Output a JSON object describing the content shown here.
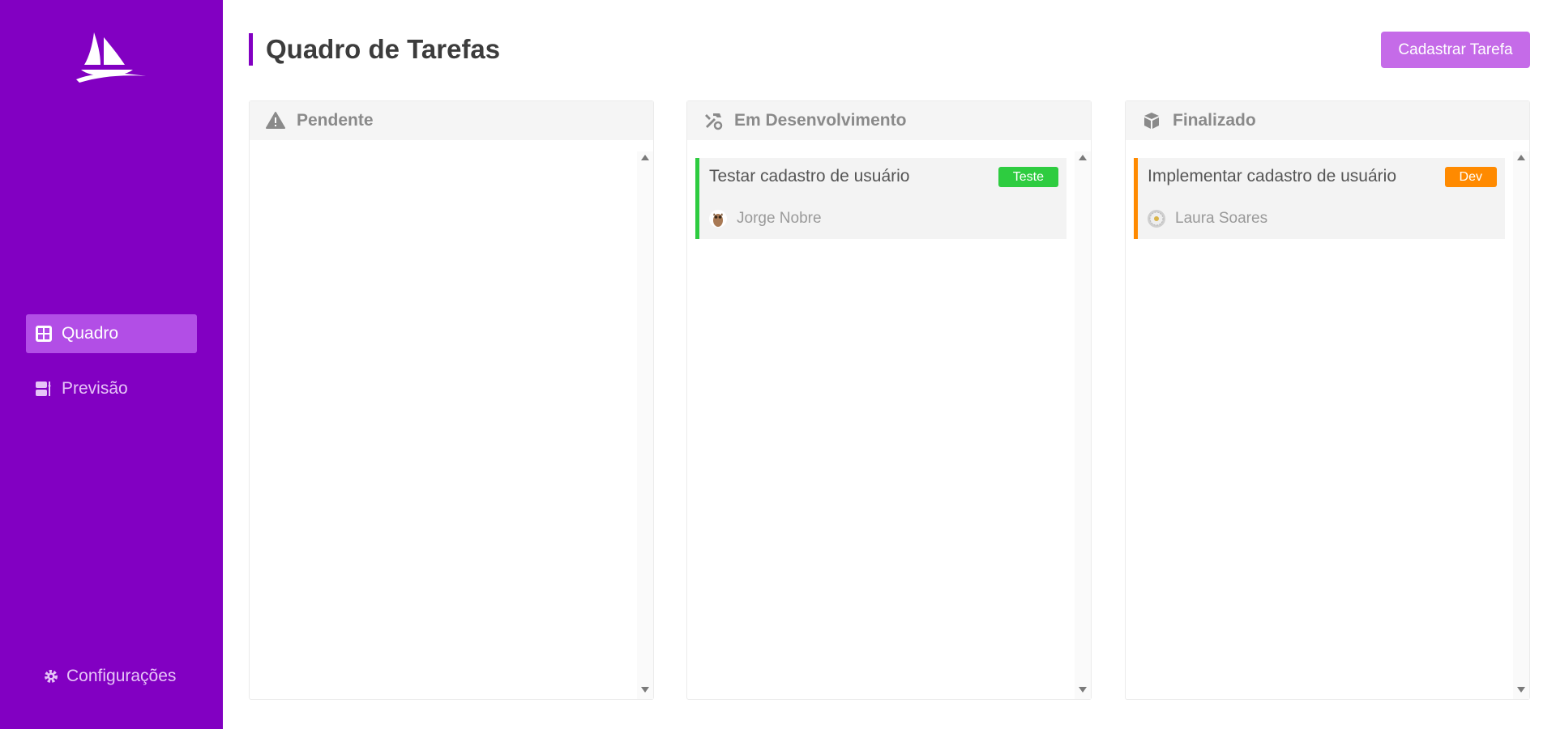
{
  "sidebar": {
    "nav": [
      {
        "label": "Quadro",
        "icon": "board-icon",
        "active": true
      },
      {
        "label": "Previsão",
        "icon": "forecast-icon",
        "active": false
      }
    ],
    "settings_label": "Configurações"
  },
  "header": {
    "title": "Quadro de Tarefas",
    "new_task_label": "Cadastrar Tarefa"
  },
  "columns": [
    {
      "title": "Pendente",
      "icon": "warning-icon",
      "cards": []
    },
    {
      "title": "Em Desenvolvimento",
      "icon": "tools-icon",
      "cards": [
        {
          "title": "Testar cadastro de usuário",
          "tag": "Teste",
          "tag_color": "#2ecc40",
          "user": "Jorge Nobre"
        }
      ]
    },
    {
      "title": "Finalizado",
      "icon": "box-icon",
      "cards": [
        {
          "title": "Implementar cadastro de usuário",
          "tag": "Dev",
          "tag_color": "#ff8a00",
          "user": "Laura Soares"
        }
      ]
    }
  ],
  "colors": {
    "sidebar": "#8200c2",
    "active_nav": "#b24ee6",
    "button": "#c56be8",
    "tag_test": "#2ecc40",
    "tag_dev": "#ff8a00"
  }
}
